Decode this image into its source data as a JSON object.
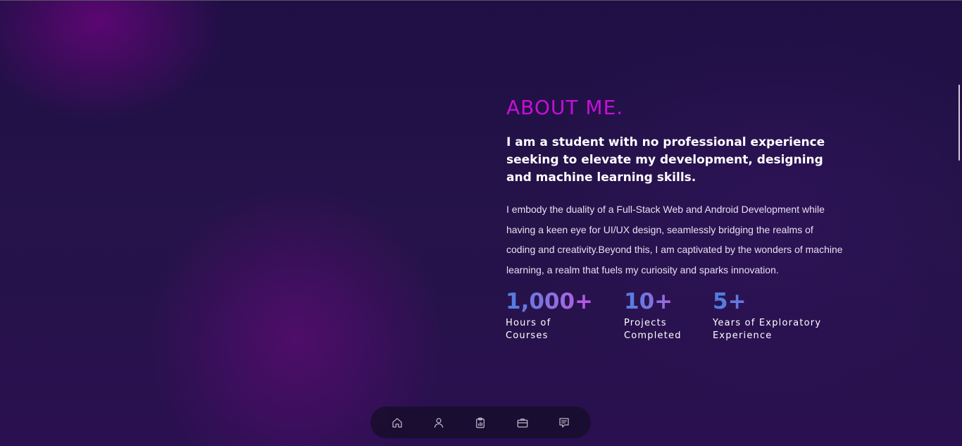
{
  "about": {
    "title": "ABOUT ME.",
    "headline": "I am a student with no professional experience seeking to elevate my development, designing and machine learning skills.",
    "body": "I embody the duality of a Full-Stack Web and Android Development while having a keen eye for UI/UX design, seamlessly bridging the realms of coding and creativity.Beyond this, I am captivated by the wonders of machine learning, a realm that fuels my curiosity and sparks innovation."
  },
  "stats": [
    {
      "value": "1,000+",
      "label_line1": "Hours of",
      "label_line2": "Courses"
    },
    {
      "value": "10+",
      "label_line1": "Projects",
      "label_line2": "Completed"
    },
    {
      "value": "5+",
      "label_line1": "Years of Exploratory",
      "label_line2": "Experience"
    }
  ],
  "nav": {
    "items": [
      {
        "icon": "home-icon"
      },
      {
        "icon": "user-icon"
      },
      {
        "icon": "clipboard-chart-icon"
      },
      {
        "icon": "briefcase-icon"
      },
      {
        "icon": "message-icon"
      }
    ]
  },
  "colors": {
    "background": "#1c0f3d",
    "title_accent": "#c80fd8",
    "stat_gradient_start": "#4c7fe0",
    "stat_gradient_end": "#d63fe8",
    "text": "#ffffff"
  }
}
